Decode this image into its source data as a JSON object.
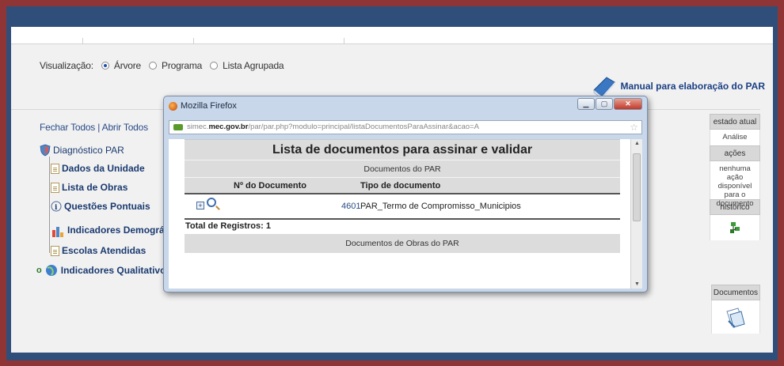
{
  "visualizacao": {
    "label": "Visualização:",
    "options": [
      "Árvore",
      "Programa",
      "Lista Agrupada"
    ],
    "selected": "Árvore"
  },
  "manual_link": "Manual para elaboração do PAR",
  "tree_controls": {
    "fechar": "Fechar Todos",
    "sep": "|",
    "abrir": "Abrir Todos"
  },
  "tree": {
    "root": "Diagnóstico PAR",
    "items": [
      "Dados da Unidade",
      "Lista de Obras",
      "Questões Pontuais",
      "Indicadores Demográficos e Ed",
      "Escolas Atendidas"
    ],
    "qualitativos": "Indicadores Qualitativos"
  },
  "right_panel": {
    "estado_title": "estado atual",
    "estado_value": "Análise",
    "acoes_title": "ações",
    "acoes_value": "nenhuma ação disponível para o documento",
    "historico_title": "histórico",
    "documentos_title": "Documentos"
  },
  "popup": {
    "window_title": "Mozilla Firefox",
    "url_prefix": "simec.",
    "url_domain": "mec.gov.br",
    "url_path": "/par/par.php?modulo=principal/listaDocumentosParaAssinar&acao=A",
    "heading": "Lista de documentos para assinar e validar",
    "section1": "Documentos do PAR",
    "col_num": "Nº do Documento",
    "col_tipo": "Tipo de documento",
    "row": {
      "num": "4601",
      "tipo": "PAR_Termo de Compromisso_Municipios"
    },
    "total": "Total de Registros: 1",
    "section2": "Documentos de Obras do PAR"
  }
}
